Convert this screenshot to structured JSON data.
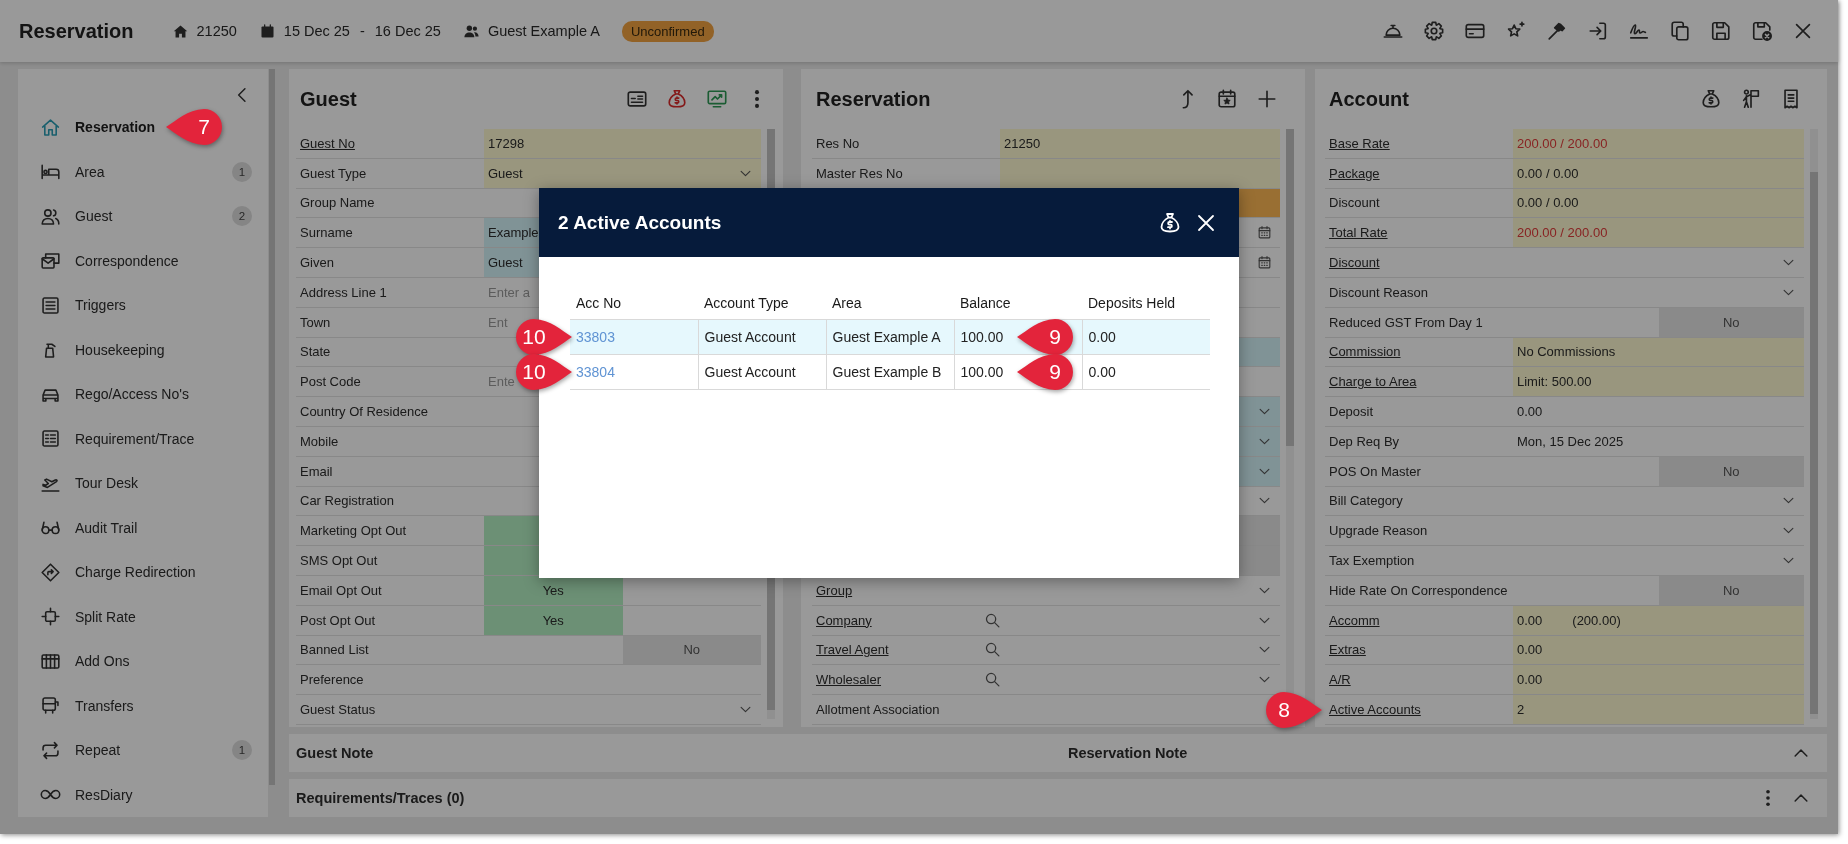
{
  "header": {
    "title": "Reservation",
    "reservation_no": "21250",
    "arrival": "15 Dec 25",
    "date_separator": "-",
    "departure": "16 Dec 25",
    "guest_name": "Guest Example A",
    "status": "Unconfirmed"
  },
  "sidebar": {
    "items": [
      {
        "label": "Reservation",
        "selected": true,
        "callout": "7"
      },
      {
        "label": "Area",
        "selected": false,
        "count": "1"
      },
      {
        "label": "Guest",
        "selected": false,
        "count": "2"
      },
      {
        "label": "Correspondence",
        "selected": false
      },
      {
        "label": "Triggers",
        "selected": false
      },
      {
        "label": "Housekeeping",
        "selected": false
      },
      {
        "label": "Rego/Access No's",
        "selected": false
      },
      {
        "label": "Requirement/Trace",
        "selected": false
      },
      {
        "label": "Tour Desk",
        "selected": false
      },
      {
        "label": "Audit Trail",
        "selected": false
      },
      {
        "label": "Charge Redirection",
        "selected": false
      },
      {
        "label": "Split Rate",
        "selected": false
      },
      {
        "label": "Add Ons",
        "selected": false
      },
      {
        "label": "Transfers",
        "selected": false
      },
      {
        "label": "Repeat",
        "selected": false,
        "count": "1"
      },
      {
        "label": "ResDiary",
        "selected": false
      }
    ]
  },
  "panels": [
    {
      "title": "Guest",
      "rows": [
        {
          "label": "Guest No",
          "link": true,
          "kind": "text",
          "read_only": true,
          "required": false,
          "flagged": false,
          "value": "17298"
        },
        {
          "label": "Guest Type",
          "link": false,
          "kind": "dropdown",
          "read_only": true,
          "required": false,
          "flagged": false,
          "value": "Guest"
        },
        {
          "label": "Group Name",
          "link": false,
          "kind": "text",
          "read_only": false,
          "required": false,
          "flagged": false
        },
        {
          "label": "Surname",
          "link": false,
          "kind": "text",
          "read_only": false,
          "required": true,
          "flagged": false,
          "value": "Example"
        },
        {
          "label": "Given",
          "link": false,
          "kind": "text",
          "read_only": false,
          "required": true,
          "flagged": false,
          "value": "Guest"
        },
        {
          "label": "Address Line 1",
          "link": false,
          "kind": "input",
          "read_only": false,
          "required": false,
          "flagged": false,
          "placeholder": "Enter a"
        },
        {
          "label": "Town",
          "link": false,
          "kind": "input",
          "read_only": false,
          "required": false,
          "flagged": false,
          "placeholder": "Ent"
        },
        {
          "label": "State",
          "link": false,
          "kind": "text",
          "read_only": false,
          "required": false,
          "flagged": false
        },
        {
          "label": "Post Code",
          "link": false,
          "kind": "input",
          "read_only": false,
          "required": false,
          "flagged": false,
          "placeholder": "Ente"
        },
        {
          "label": "Country Of Residence",
          "link": false,
          "kind": "text",
          "read_only": false,
          "required": false,
          "flagged": false
        },
        {
          "label": "Mobile",
          "link": false,
          "kind": "text",
          "read_only": false,
          "required": false,
          "flagged": false
        },
        {
          "label": "Email",
          "link": false,
          "kind": "text",
          "read_only": false,
          "required": false,
          "flagged": false
        },
        {
          "label": "Car Registration",
          "link": false,
          "kind": "text",
          "read_only": false,
          "required": false,
          "flagged": false
        },
        {
          "label": "Marketing Opt Out",
          "link": false,
          "kind": "toggle",
          "on": true
        },
        {
          "label": "SMS Opt Out",
          "link": false,
          "kind": "toggle",
          "on": true
        },
        {
          "label": "Email Opt Out",
          "link": false,
          "kind": "toggle",
          "on": true,
          "value": "Yes"
        },
        {
          "label": "Post Opt Out",
          "link": false,
          "kind": "toggle",
          "on": true,
          "value": "Yes"
        },
        {
          "label": "Banned List",
          "link": false,
          "kind": "toggle",
          "on": false,
          "value": "No"
        },
        {
          "label": "Preference",
          "link": false,
          "kind": "text",
          "read_only": false,
          "required": false,
          "flagged": false
        },
        {
          "label": "Guest Status",
          "link": false,
          "kind": "dropdown",
          "read_only": false,
          "required": false,
          "flagged": false
        }
      ]
    },
    {
      "title": "Reservation",
      "rows": [
        {
          "label": "Res No",
          "link": false,
          "kind": "text",
          "read_only": true,
          "required": false,
          "flagged": false,
          "value": "21250"
        },
        {
          "label": "Master Res No",
          "link": false,
          "kind": "text",
          "read_only": true,
          "required": false,
          "flagged": false
        },
        {
          "kind": "text",
          "read_only": false,
          "required": false,
          "flagged": true
        },
        {
          "kind": "date",
          "read_only": false,
          "required": false,
          "flagged": false
        },
        {
          "kind": "date",
          "read_only": false,
          "required": false,
          "flagged": false
        },
        {
          "kind": "text",
          "read_only": false,
          "required": false,
          "flagged": false
        },
        {
          "kind": "text",
          "read_only": false,
          "required": false,
          "flagged": false
        },
        {
          "kind": "text",
          "read_only": false,
          "required": true,
          "flagged": false
        },
        {
          "kind": "text",
          "read_only": false,
          "required": false,
          "flagged": false
        },
        {
          "kind": "dropdown",
          "read_only": false,
          "required": true,
          "flagged": false
        },
        {
          "kind": "dropdown",
          "read_only": false,
          "required": true,
          "flagged": false
        },
        {
          "kind": "dropdown",
          "read_only": false,
          "required": true,
          "flagged": false
        },
        {
          "kind": "dropdown",
          "read_only": false,
          "required": false,
          "flagged": false
        },
        {
          "kind": "toggle",
          "on": false
        },
        {
          "kind": "toggle",
          "on": false
        },
        {
          "label": "Group",
          "link": true,
          "kind": "dropdown",
          "read_only": false,
          "required": false,
          "flagged": false
        },
        {
          "label": "Company",
          "link": true,
          "kind": "lookup",
          "read_only": false,
          "required": false,
          "flagged": false
        },
        {
          "label": "Travel Agent",
          "link": true,
          "kind": "lookup",
          "read_only": false,
          "required": false,
          "flagged": false
        },
        {
          "label": "Wholesaler",
          "link": true,
          "kind": "lookup",
          "read_only": false,
          "required": false,
          "flagged": false
        },
        {
          "label": "Allotment Association",
          "link": false,
          "kind": "text",
          "read_only": false,
          "required": false,
          "flagged": false
        }
      ]
    },
    {
      "title": "Account",
      "rows": [
        {
          "label": "Base Rate",
          "link": true,
          "kind": "text",
          "read_only": true,
          "required": false,
          "flagged": false,
          "value": "200.00 / 200.00",
          "highlight": true
        },
        {
          "label": "Package",
          "link": true,
          "kind": "text",
          "read_only": true,
          "required": false,
          "flagged": false,
          "value": "0.00 / 0.00",
          "highlight": false
        },
        {
          "label": "Discount",
          "link": false,
          "kind": "text",
          "read_only": true,
          "required": false,
          "flagged": false,
          "value": "0.00 / 0.00",
          "highlight": false
        },
        {
          "label": "Total Rate",
          "link": true,
          "kind": "text",
          "read_only": true,
          "required": false,
          "flagged": false,
          "value": "200.00 / 200.00",
          "highlight": true
        },
        {
          "label": "Discount",
          "link": true,
          "kind": "dropdown",
          "read_only": false,
          "required": false,
          "flagged": false
        },
        {
          "label": "Discount Reason",
          "link": false,
          "kind": "dropdown",
          "read_only": false,
          "required": false,
          "flagged": false
        },
        {
          "label": "Reduced GST From Day 1",
          "link": false,
          "kind": "toggle",
          "on": false,
          "value": "No"
        },
        {
          "label": "Commission",
          "link": true,
          "kind": "text",
          "read_only": true,
          "required": false,
          "flagged": false,
          "value": "No Commissions",
          "highlight": false
        },
        {
          "label": "Charge to Area",
          "link": true,
          "kind": "text",
          "read_only": true,
          "required": false,
          "flagged": false,
          "value": "Limit: 500.00",
          "highlight": false
        },
        {
          "label": "Deposit",
          "link": false,
          "kind": "text",
          "read_only": false,
          "required": false,
          "flagged": false,
          "value": "0.00",
          "highlight": false
        },
        {
          "label": "Dep Req By",
          "link": false,
          "kind": "text",
          "read_only": false,
          "required": false,
          "flagged": false,
          "value": "Mon, 15 Dec 2025",
          "highlight": false
        },
        {
          "label": "POS On Master",
          "link": false,
          "kind": "toggle",
          "on": false,
          "value": "No"
        },
        {
          "label": "Bill Category",
          "link": false,
          "kind": "dropdown",
          "read_only": false,
          "required": false,
          "flagged": false
        },
        {
          "label": "Upgrade Reason",
          "link": false,
          "kind": "dropdown",
          "read_only": false,
          "required": false,
          "flagged": false
        },
        {
          "label": "Tax Exemption",
          "link": false,
          "kind": "dropdown",
          "read_only": false,
          "required": false,
          "flagged": false
        },
        {
          "label": "Hide Rate On Correspondence",
          "link": false,
          "kind": "toggle",
          "on": false,
          "value": "No"
        },
        {
          "label": "Accomm",
          "link": true,
          "kind": "text",
          "read_only": true,
          "required": false,
          "flagged": false,
          "value": "0.00",
          "secondary_value": "(200.00)",
          "highlight": false
        },
        {
          "label": "Extras",
          "link": true,
          "kind": "text",
          "read_only": true,
          "required": false,
          "flagged": false,
          "value": "0.00",
          "highlight": false
        },
        {
          "label": "A/R",
          "link": true,
          "kind": "text",
          "read_only": true,
          "required": false,
          "flagged": false,
          "value": "0.00",
          "highlight": false
        },
        {
          "label": "Active Accounts",
          "link": true,
          "kind": "text",
          "read_only": true,
          "required": false,
          "flagged": false,
          "value": "2",
          "highlight": false,
          "callout": "8"
        }
      ]
    }
  ],
  "notes_bar": {
    "sections": [
      "Guest Note",
      "Reservation Note"
    ]
  },
  "requirements_bar": {
    "title": "Requirements/Traces (0)"
  },
  "modal": {
    "title": "2 Active Accounts",
    "columns": [
      "Acc No",
      "Account Type",
      "Area",
      "Balance",
      "Deposits Held"
    ],
    "rows": [
      {
        "selected": true,
        "cells": [
          {
            "kind": "link",
            "text": "33803",
            "callout": "10"
          },
          {
            "kind": "text",
            "text": "Guest Account"
          },
          {
            "kind": "text",
            "text": "Guest Example A"
          },
          {
            "kind": "text",
            "text": "100.00",
            "callout": "9"
          },
          {
            "kind": "text",
            "text": "0.00"
          }
        ]
      },
      {
        "selected": false,
        "cells": [
          {
            "kind": "link",
            "text": "33804",
            "callout": "10"
          },
          {
            "kind": "text",
            "text": "Guest Account"
          },
          {
            "kind": "text",
            "text": "Guest Example B"
          },
          {
            "kind": "text",
            "text": "100.00",
            "callout": "9"
          },
          {
            "kind": "text",
            "text": "0.00"
          }
        ]
      }
    ]
  }
}
